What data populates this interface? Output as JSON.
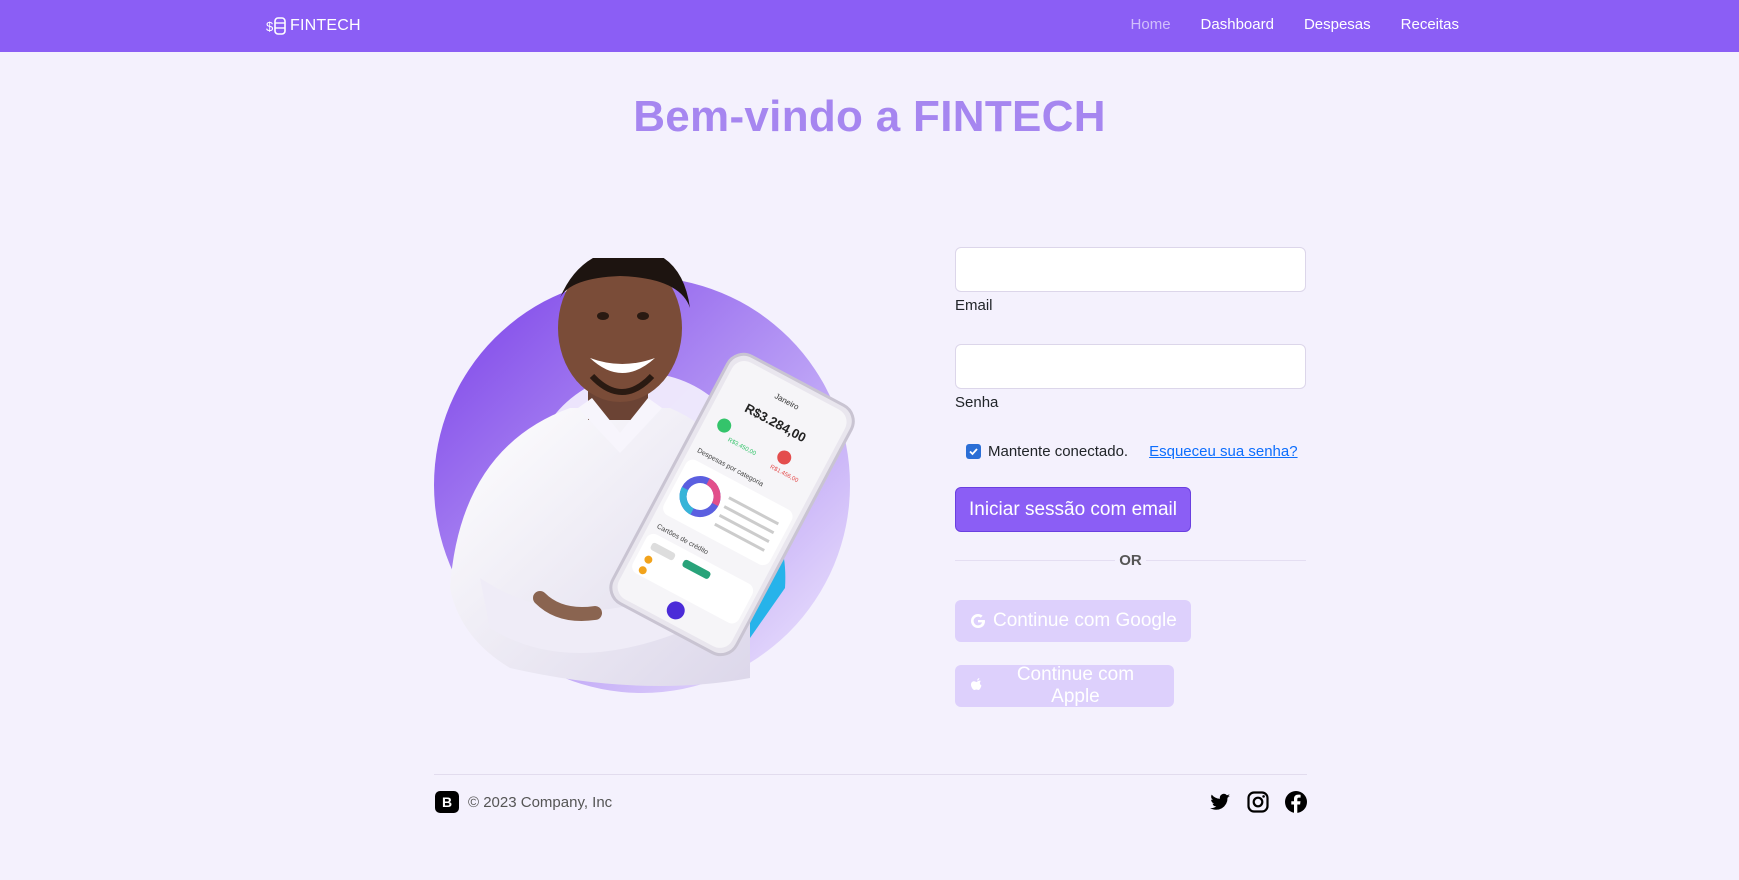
{
  "navbar": {
    "brand": "FINTECH",
    "links": [
      {
        "label": "Home",
        "active": true
      },
      {
        "label": "Dashboard"
      },
      {
        "label": "Despesas"
      },
      {
        "label": "Receitas"
      }
    ]
  },
  "hero": {
    "title": "Bem-vindo a FINTECH",
    "phone": {
      "user": "Janeiro",
      "balance": "R$3.284,00",
      "income": "R$3.450,00",
      "expense": "R$1.456,00",
      "section1": "Despesas por categoria",
      "section2": "Cartões de crédito"
    }
  },
  "form": {
    "email_label": "Email",
    "password_label": "Senha",
    "remember_label": "Mantente conectado.",
    "remember_checked": true,
    "forgot_link": "Esqueceu sua senha?",
    "submit_label": "Iniciar sessão com email",
    "divider": "OR",
    "google_label": "Continue com Google",
    "apple_label": "Continue com Apple"
  },
  "footer": {
    "copyright": "© 2023 Company, Inc",
    "social_icons": [
      "twitter-icon",
      "instagram-icon",
      "facebook-icon"
    ]
  },
  "colors": {
    "navbar_bg": "#8b5ef5",
    "title": "#a686f0",
    "page_bg": "#f4f1fd",
    "primary_button": "#8b5ef5",
    "social_button": "#ddd0fc"
  }
}
